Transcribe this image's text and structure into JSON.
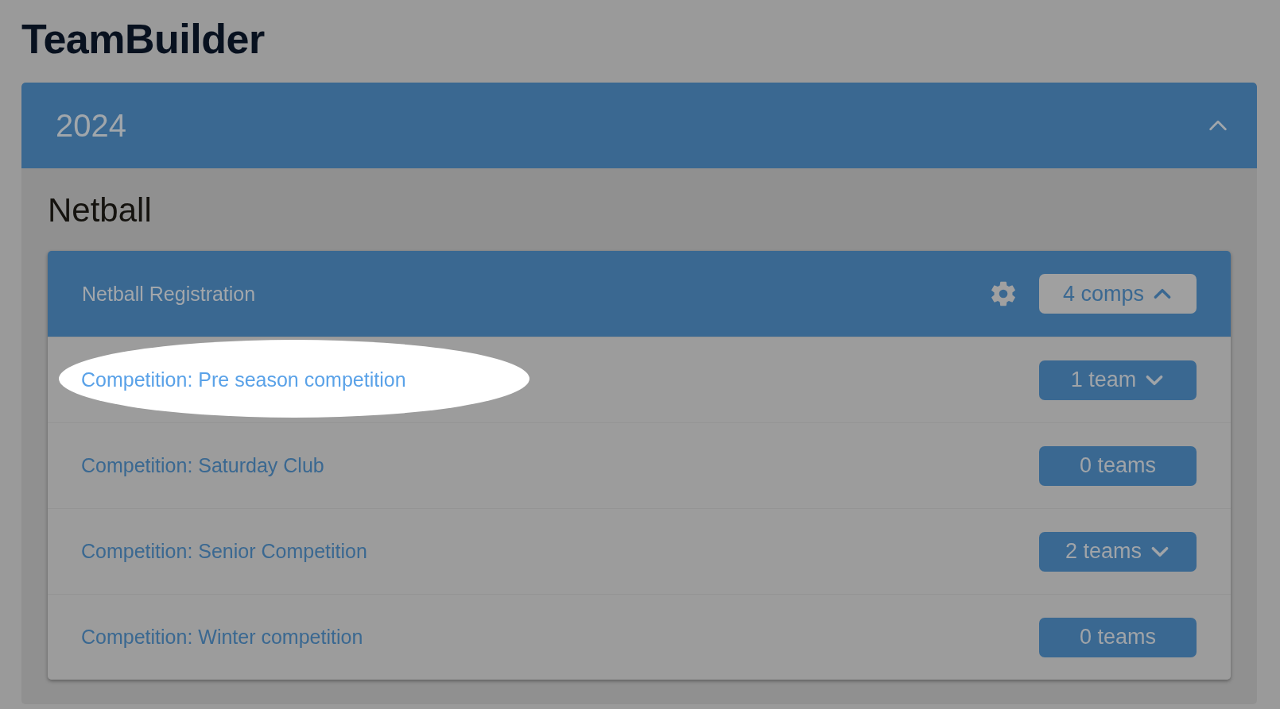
{
  "app_title": "TeamBuilder",
  "year_panel": {
    "title": "2024",
    "expanded": true,
    "sport": "Netball",
    "registration": {
      "title": "Netball Registration",
      "count_label": "4 comps",
      "expanded": true,
      "competitions": [
        {
          "name": "Competition: Pre season competition",
          "teams_label": "1 team",
          "has_teams": true,
          "highlighted": true
        },
        {
          "name": "Competition: Saturday Club",
          "teams_label": "0 teams",
          "has_teams": false,
          "highlighted": false
        },
        {
          "name": "Competition: Senior Competition",
          "teams_label": "2 teams",
          "has_teams": true,
          "highlighted": false
        },
        {
          "name": "Competition: Winter competition",
          "teams_label": "0 teams",
          "has_teams": false,
          "highlighted": false
        }
      ]
    }
  }
}
